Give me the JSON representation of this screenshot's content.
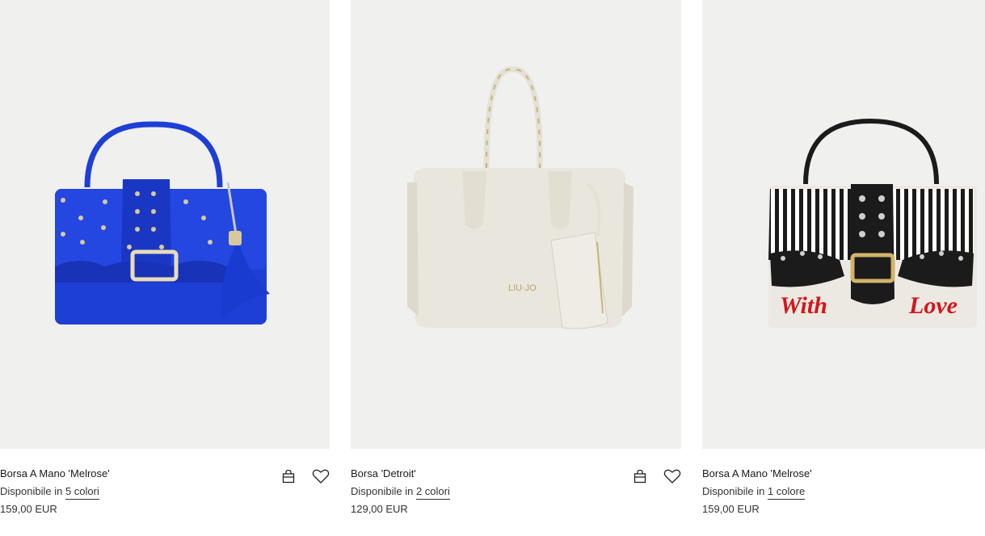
{
  "products": [
    {
      "name": "Borsa A Mano 'Melrose'",
      "availability_prefix": "Disponibile in",
      "availability_link": "5 colori",
      "price": "159,00 EUR",
      "image_icon": "blue-handbag-image",
      "actions": [
        "bag-icon",
        "heart-icon"
      ]
    },
    {
      "name": "Borsa 'Detroit'",
      "availability_prefix": "Disponibile in",
      "availability_link": "2 colori",
      "price": "129,00 EUR",
      "image_icon": "cream-handbag-image",
      "logo_text": "LIU·JO",
      "actions": [
        "bag-icon",
        "heart-icon"
      ]
    },
    {
      "name": "Borsa A Mano 'Melrose'",
      "availability_prefix": "Disponibile in",
      "availability_link": "1 colore",
      "price": "159,00 EUR",
      "image_icon": "striped-handbag-image",
      "print_text_1": "With",
      "print_text_2": "Love"
    }
  ],
  "colors": {
    "image_background": "#f0f0ee",
    "blue_bag": "#1e3fd6",
    "cream_bag": "#e9e6dd",
    "stripe_bag_dark": "#1b1b1b",
    "love_red": "#d3161c"
  }
}
